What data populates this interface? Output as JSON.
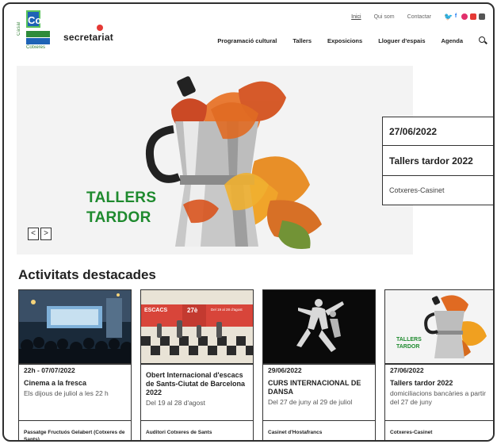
{
  "logo": {
    "vertical_text": "Casal",
    "badge": "Co",
    "bottom_text": "Cotxeres"
  },
  "brand": "secretariat",
  "topbar": {
    "links": [
      "Inici",
      "Qui som",
      "Contactar"
    ],
    "social_icons": [
      "twitter-icon",
      "facebook-icon",
      "instagram-icon",
      "youtube-icon",
      "mail-icon"
    ]
  },
  "nav": {
    "items": [
      "Programació cultural",
      "Tallers",
      "Exposicions",
      "Lloguer d'espais",
      "Agenda"
    ]
  },
  "hero": {
    "title_line1": "TALLERS",
    "title_line2": "TARDOR",
    "prev_label": "<",
    "next_label": ">",
    "event": {
      "date": "27/06/2022",
      "title": "Tallers tardor 2022",
      "location": "Cotxeres-Casinet"
    }
  },
  "section": {
    "title": "Activitats destacades"
  },
  "cards": [
    {
      "date": "22h - 07/07/2022",
      "title": "Cinema a la fresca",
      "desc": "Els dijous de juliol a les 22 h",
      "location": "Passatge Fructuós Gelabert (Cotxeres de Sants)"
    },
    {
      "date": "",
      "title": "Obert Internacional d'escacs de Sants-Ciutat de Barcelona 2022",
      "desc": "Del 19 al 28 d'agost",
      "location": "Auditori Cotxeres de Sants",
      "thumb_text_left": "ESCACS",
      "thumb_text_mid": "27è",
      "thumb_text_right": "Del 19 al 28 d'agost"
    },
    {
      "date": "29/06/2022",
      "title": "CURS INTERNACIONAL DE DANSA",
      "desc": "Del 27 de juny al 29 de juliol",
      "location": "Casinet d'Hostafrancs"
    },
    {
      "date": "27/06/2022",
      "title": "Tallers tardor 2022",
      "desc": "domiciliacions bancàries a partir del 27 de juny",
      "location": "Cotxeres-Casinet",
      "thumb_title_line1": "TALLERS",
      "thumb_title_line2": "TARDOR"
    }
  ],
  "colors": {
    "green": "#1e8a2e",
    "blue": "#1e63b6",
    "red": "#e53935",
    "orange": "#e8742a"
  }
}
